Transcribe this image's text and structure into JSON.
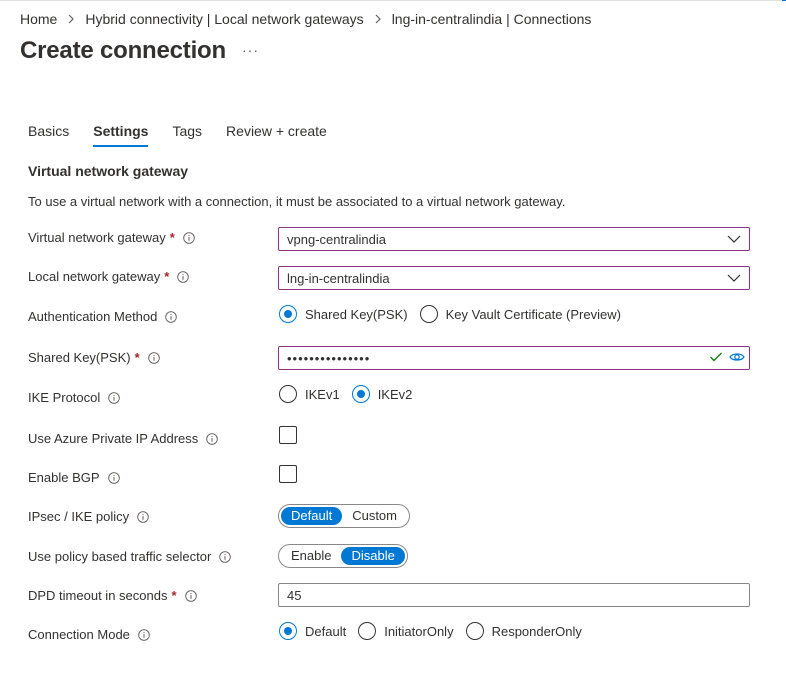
{
  "breadcrumb": {
    "items": [
      "Home",
      "Hybrid connectivity | Local network gateways",
      "lng-in-centralindia | Connections"
    ]
  },
  "page": {
    "title": "Create connection",
    "more": "···"
  },
  "tabs": [
    "Basics",
    "Settings",
    "Tags",
    "Review + create"
  ],
  "active_tab": "Settings",
  "section": {
    "title": "Virtual network gateway",
    "description": "To use a virtual network with a connection, it must be associated to a virtual network gateway."
  },
  "fields": {
    "vng": {
      "label": "Virtual network gateway",
      "required": "*",
      "value": "vpng-centralindia"
    },
    "lng": {
      "label": "Local network gateway",
      "required": "*",
      "value": "lng-in-centralindia"
    },
    "auth": {
      "label": "Authentication Method",
      "options": [
        "Shared Key(PSK)",
        "Key Vault Certificate (Preview)"
      ],
      "selected": "Shared Key(PSK)"
    },
    "psk": {
      "label": "Shared Key(PSK)",
      "required": "*",
      "value": "•••••••••••••••"
    },
    "ike": {
      "label": "IKE Protocol",
      "options": [
        "IKEv1",
        "IKEv2"
      ],
      "selected": "IKEv2"
    },
    "private_ip": {
      "label": "Use Azure Private IP Address",
      "checked": false
    },
    "bgp": {
      "label": "Enable BGP",
      "checked": false
    },
    "ipsec": {
      "label": "IPsec / IKE policy",
      "options": [
        "Default",
        "Custom"
      ],
      "selected": "Default"
    },
    "policy_selector": {
      "label": "Use policy based traffic selector",
      "options": [
        "Enable",
        "Disable"
      ],
      "selected": "Disable"
    },
    "dpd": {
      "label": "DPD timeout in seconds",
      "required": "*",
      "value": "45"
    },
    "mode": {
      "label": "Connection Mode",
      "options": [
        "Default",
        "InitiatorOnly",
        "ResponderOnly"
      ],
      "selected": "Default"
    }
  },
  "icons": {
    "info": "info-icon",
    "chevron": "chevron-down-icon",
    "breadcrumb_sep": "chevron-right-icon",
    "valid": "checkmark-icon",
    "reveal": "eye-icon"
  },
  "colors": {
    "accent": "#0078d4",
    "required": "#a4262c",
    "focus_border": "#8c2f8f",
    "valid": "#107c10"
  }
}
